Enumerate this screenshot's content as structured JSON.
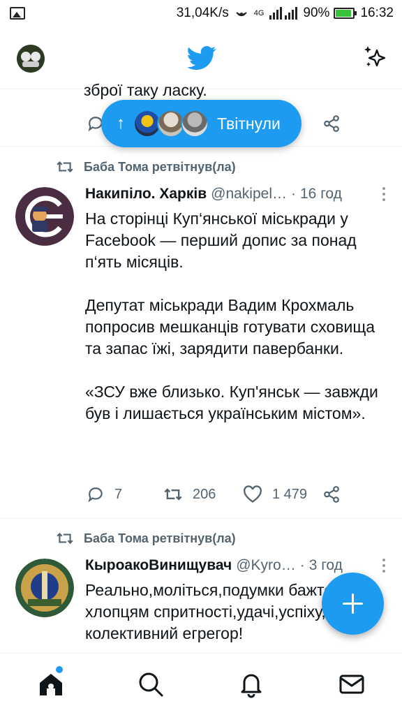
{
  "status_bar": {
    "speed": "31,04K/s",
    "network": "4G",
    "battery": "90%",
    "battery_level": 0.9,
    "time": "16:32"
  },
  "partial_tweet": {
    "text": "зброї таку ласку."
  },
  "new_tweets_pill": {
    "label": "Твітнули"
  },
  "tweets": [
    {
      "retweeted_by": "Баба Тома ретвітнув(ла)",
      "name": "Накипіло. Харків",
      "handle": "@nakipel…",
      "dot": "·",
      "time": "16 год",
      "paragraphs": [
        "На сторінці Куп‘янської міськради у Facebook — перший допис за понад п‘ять місяців.",
        "Депутат міськради Вадим Крохмаль попросив мешканців готувати сховища та запас їжі, зарядити павербанки.",
        "«ЗСУ вже близько. Куп'янськ — завжди був і лишається українським містом»."
      ],
      "replies": "7",
      "retweets": "206",
      "likes": "1 479"
    },
    {
      "retweeted_by": "Баба Тома ретвітнув(ла)",
      "name": "КыроакоВинищувач",
      "handle": "@Kyro…",
      "dot": "·",
      "time": "3 год",
      "paragraphs": [
        "Реально,моліться,подумки бажте хлопцям спритності,удачі,успіху, колективний егрегор!"
      ]
    }
  ],
  "colors": {
    "accent": "#1d9bf0",
    "secondary_text": "#536471",
    "primary_text": "#0f1419",
    "battery": "#39c33a"
  }
}
